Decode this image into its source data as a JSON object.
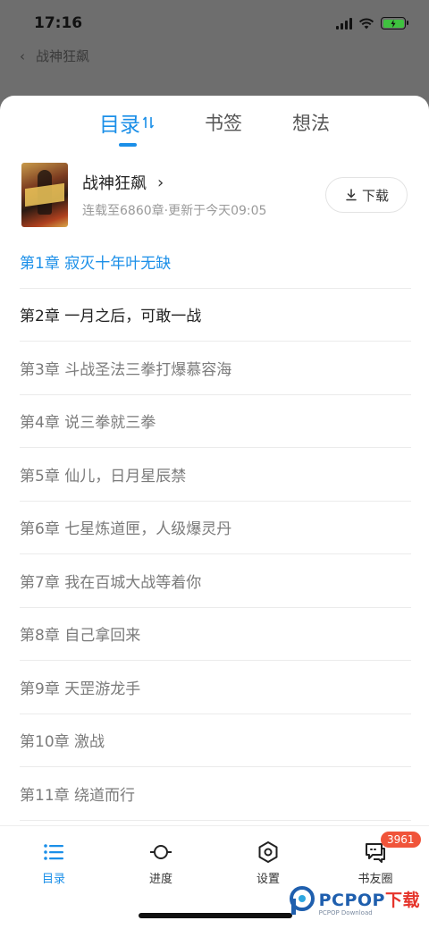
{
  "status_bar": {
    "time": "17:16"
  },
  "background_page": {
    "title": "战神狂飙",
    "back_glyph": "‹"
  },
  "tabs": [
    {
      "label": "目录",
      "active": true,
      "sort_glyph": "⇅"
    },
    {
      "label": "书签",
      "active": false
    },
    {
      "label": "想法",
      "active": false
    }
  ],
  "book": {
    "title": "战神狂飙",
    "title_chevron": "›",
    "meta": "连载至6860章·更新于今天09:05",
    "download_label": "下载"
  },
  "chapters": [
    {
      "label": "第1章  寂灭十年叶无缺",
      "state": "current"
    },
    {
      "label": "第2章  一月之后，可敢一战",
      "state": "read"
    },
    {
      "label": "第3章  斗战圣法三拳打爆慕容海",
      "state": "unread"
    },
    {
      "label": "第4章  说三拳就三拳",
      "state": "unread"
    },
    {
      "label": "第5章  仙儿，日月星辰禁",
      "state": "unread"
    },
    {
      "label": "第6章  七星炼道匣，人级爆灵丹",
      "state": "unread"
    },
    {
      "label": "第7章  我在百城大战等着你",
      "state": "unread"
    },
    {
      "label": "第8章  自己拿回来",
      "state": "unread"
    },
    {
      "label": "第9章  天罡游龙手",
      "state": "unread"
    },
    {
      "label": "第10章  激战",
      "state": "unread"
    },
    {
      "label": "第11章  绕道而行",
      "state": "unread"
    }
  ],
  "bottom_nav": [
    {
      "label": "目录",
      "icon": "list-icon",
      "active": true
    },
    {
      "label": "进度",
      "icon": "progress-icon",
      "active": false
    },
    {
      "label": "设置",
      "icon": "settings-icon",
      "active": false
    },
    {
      "label": "书友圈",
      "icon": "chat-icon",
      "active": false,
      "badge": "3961"
    }
  ],
  "watermark": {
    "brand_blue": "PCPOP",
    "brand_red": "下载",
    "sub": "PCPOP Download"
  },
  "colors": {
    "accent": "#1b8fe8",
    "badge": "#f0543a",
    "battery": "#3fc23f"
  }
}
